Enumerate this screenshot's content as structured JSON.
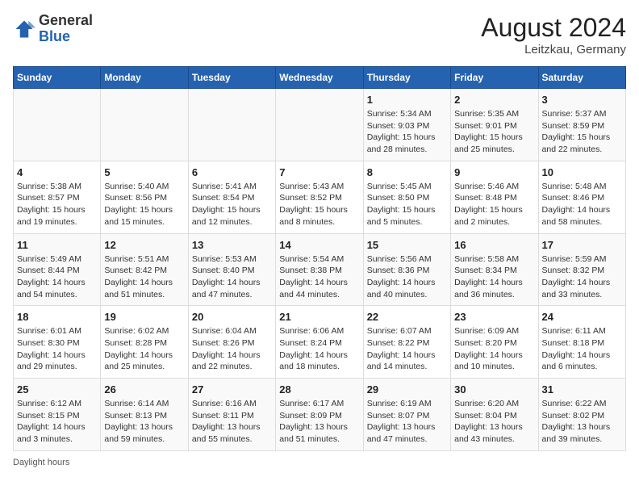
{
  "header": {
    "logo": {
      "line1": "General",
      "line2": "Blue"
    },
    "title": "August 2024",
    "location": "Leitzkau, Germany"
  },
  "days_of_week": [
    "Sunday",
    "Monday",
    "Tuesday",
    "Wednesday",
    "Thursday",
    "Friday",
    "Saturday"
  ],
  "weeks": [
    [
      {
        "day": "",
        "info": ""
      },
      {
        "day": "",
        "info": ""
      },
      {
        "day": "",
        "info": ""
      },
      {
        "day": "",
        "info": ""
      },
      {
        "day": "1",
        "info": "Sunrise: 5:34 AM\nSunset: 9:03 PM\nDaylight: 15 hours and 28 minutes."
      },
      {
        "day": "2",
        "info": "Sunrise: 5:35 AM\nSunset: 9:01 PM\nDaylight: 15 hours and 25 minutes."
      },
      {
        "day": "3",
        "info": "Sunrise: 5:37 AM\nSunset: 8:59 PM\nDaylight: 15 hours and 22 minutes."
      }
    ],
    [
      {
        "day": "4",
        "info": "Sunrise: 5:38 AM\nSunset: 8:57 PM\nDaylight: 15 hours and 19 minutes."
      },
      {
        "day": "5",
        "info": "Sunrise: 5:40 AM\nSunset: 8:56 PM\nDaylight: 15 hours and 15 minutes."
      },
      {
        "day": "6",
        "info": "Sunrise: 5:41 AM\nSunset: 8:54 PM\nDaylight: 15 hours and 12 minutes."
      },
      {
        "day": "7",
        "info": "Sunrise: 5:43 AM\nSunset: 8:52 PM\nDaylight: 15 hours and 8 minutes."
      },
      {
        "day": "8",
        "info": "Sunrise: 5:45 AM\nSunset: 8:50 PM\nDaylight: 15 hours and 5 minutes."
      },
      {
        "day": "9",
        "info": "Sunrise: 5:46 AM\nSunset: 8:48 PM\nDaylight: 15 hours and 2 minutes."
      },
      {
        "day": "10",
        "info": "Sunrise: 5:48 AM\nSunset: 8:46 PM\nDaylight: 14 hours and 58 minutes."
      }
    ],
    [
      {
        "day": "11",
        "info": "Sunrise: 5:49 AM\nSunset: 8:44 PM\nDaylight: 14 hours and 54 minutes."
      },
      {
        "day": "12",
        "info": "Sunrise: 5:51 AM\nSunset: 8:42 PM\nDaylight: 14 hours and 51 minutes."
      },
      {
        "day": "13",
        "info": "Sunrise: 5:53 AM\nSunset: 8:40 PM\nDaylight: 14 hours and 47 minutes."
      },
      {
        "day": "14",
        "info": "Sunrise: 5:54 AM\nSunset: 8:38 PM\nDaylight: 14 hours and 44 minutes."
      },
      {
        "day": "15",
        "info": "Sunrise: 5:56 AM\nSunset: 8:36 PM\nDaylight: 14 hours and 40 minutes."
      },
      {
        "day": "16",
        "info": "Sunrise: 5:58 AM\nSunset: 8:34 PM\nDaylight: 14 hours and 36 minutes."
      },
      {
        "day": "17",
        "info": "Sunrise: 5:59 AM\nSunset: 8:32 PM\nDaylight: 14 hours and 33 minutes."
      }
    ],
    [
      {
        "day": "18",
        "info": "Sunrise: 6:01 AM\nSunset: 8:30 PM\nDaylight: 14 hours and 29 minutes."
      },
      {
        "day": "19",
        "info": "Sunrise: 6:02 AM\nSunset: 8:28 PM\nDaylight: 14 hours and 25 minutes."
      },
      {
        "day": "20",
        "info": "Sunrise: 6:04 AM\nSunset: 8:26 PM\nDaylight: 14 hours and 22 minutes."
      },
      {
        "day": "21",
        "info": "Sunrise: 6:06 AM\nSunset: 8:24 PM\nDaylight: 14 hours and 18 minutes."
      },
      {
        "day": "22",
        "info": "Sunrise: 6:07 AM\nSunset: 8:22 PM\nDaylight: 14 hours and 14 minutes."
      },
      {
        "day": "23",
        "info": "Sunrise: 6:09 AM\nSunset: 8:20 PM\nDaylight: 14 hours and 10 minutes."
      },
      {
        "day": "24",
        "info": "Sunrise: 6:11 AM\nSunset: 8:18 PM\nDaylight: 14 hours and 6 minutes."
      }
    ],
    [
      {
        "day": "25",
        "info": "Sunrise: 6:12 AM\nSunset: 8:15 PM\nDaylight: 14 hours and 3 minutes."
      },
      {
        "day": "26",
        "info": "Sunrise: 6:14 AM\nSunset: 8:13 PM\nDaylight: 13 hours and 59 minutes."
      },
      {
        "day": "27",
        "info": "Sunrise: 6:16 AM\nSunset: 8:11 PM\nDaylight: 13 hours and 55 minutes."
      },
      {
        "day": "28",
        "info": "Sunrise: 6:17 AM\nSunset: 8:09 PM\nDaylight: 13 hours and 51 minutes."
      },
      {
        "day": "29",
        "info": "Sunrise: 6:19 AM\nSunset: 8:07 PM\nDaylight: 13 hours and 47 minutes."
      },
      {
        "day": "30",
        "info": "Sunrise: 6:20 AM\nSunset: 8:04 PM\nDaylight: 13 hours and 43 minutes."
      },
      {
        "day": "31",
        "info": "Sunrise: 6:22 AM\nSunset: 8:02 PM\nDaylight: 13 hours and 39 minutes."
      }
    ]
  ],
  "footer": "Daylight hours"
}
